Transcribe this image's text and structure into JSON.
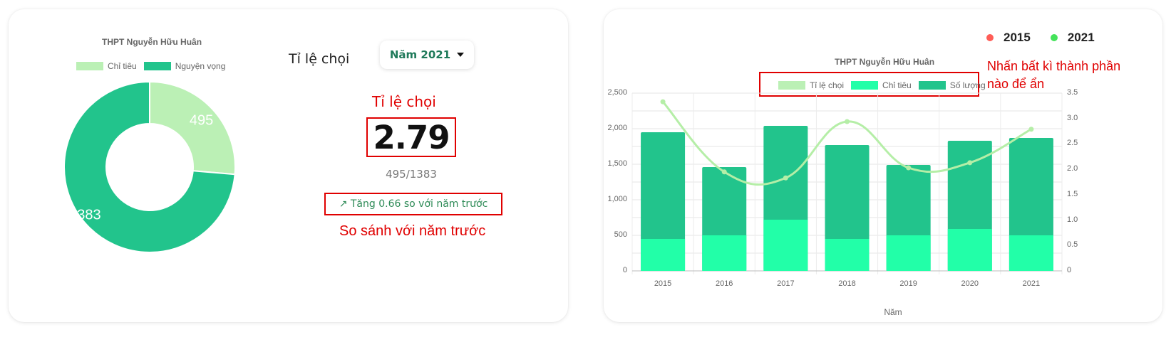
{
  "donut": {
    "title": "THPT Nguyễn Hữu Huân",
    "legend": [
      {
        "label": "Chỉ tiêu",
        "color": "#bbf0b5"
      },
      {
        "label": "Nguyện vọng",
        "color": "#22c48c"
      }
    ]
  },
  "panel": {
    "heading": "Tỉ lệ chọi",
    "year_select": "Năm 2021",
    "annotation_rate": "Tỉ lệ chọi",
    "rate": "2.79",
    "ratio": "495/1383",
    "compare": "↗ Tăng 0.66 so với năm trước",
    "annotation_compare": "So sánh với năm trước"
  },
  "bar": {
    "title": "THPT Nguyễn Hữu Huân",
    "legend": [
      {
        "label": "Tỉ lệ chọi",
        "color": "#bbf0b5"
      },
      {
        "label": "Chỉ tiêu",
        "color": "#22ffa8"
      },
      {
        "label": "Số lượng",
        "color": "#22c48c"
      }
    ],
    "series_toggle": [
      {
        "label": "2015",
        "color": "#ff5d57"
      },
      {
        "label": "2021",
        "color": "#44e35a"
      }
    ],
    "hint": "Nhấn bất kì thành phần nào để ẩn"
  },
  "chart_data": [
    {
      "type": "pie",
      "title": "THPT Nguyễn Hữu Huân",
      "categories": [
        "Chỉ tiêu",
        "Nguyện vọng"
      ],
      "values": [
        495,
        1383
      ],
      "legend_position": "top",
      "colors": [
        "#bbf0b5",
        "#22c48c"
      ]
    },
    {
      "type": "bar",
      "title": "THPT Nguyễn Hữu Huân",
      "xlabel": "Năm",
      "categories": [
        "2015",
        "2016",
        "2017",
        "2018",
        "2019",
        "2020",
        "2021"
      ],
      "series": [
        {
          "name": "Chỉ tiêu",
          "type": "bar",
          "axis": "left",
          "color": "#22ffa8",
          "values": [
            450,
            500,
            720,
            450,
            500,
            590,
            500
          ]
        },
        {
          "name": "Số lượng",
          "type": "bar",
          "axis": "left",
          "color": "#22c48c",
          "values": [
            1950,
            1460,
            2040,
            1770,
            1490,
            1830,
            1870
          ]
        },
        {
          "name": "Tỉ lệ chọi",
          "type": "line",
          "axis": "right",
          "color": "#b5eea7",
          "values": [
            3.33,
            1.95,
            1.83,
            2.94,
            2.03,
            2.13,
            2.79
          ]
        }
      ],
      "ylim": [
        0,
        2500
      ],
      "yticks": [
        "0",
        "500",
        "1,000",
        "1,500",
        "2,000",
        "2,500"
      ],
      "y2lim": [
        0,
        3.5
      ],
      "y2ticks": [
        "0",
        "0.5",
        "1.0",
        "1.5",
        "2.0",
        "2.5",
        "3.0",
        "3.5"
      ],
      "stacked": "overlay",
      "grid": true,
      "legend_position": "top"
    }
  ]
}
